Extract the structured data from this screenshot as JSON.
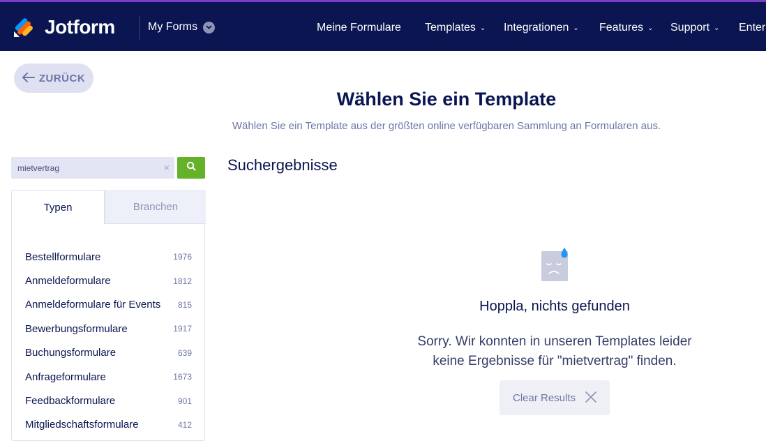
{
  "header": {
    "brand": "Jotform",
    "my_forms": "My Forms",
    "nav": [
      {
        "label": "Meine Formulare",
        "has_caret": false
      },
      {
        "label": "Templates",
        "has_caret": true
      },
      {
        "label": "Integrationen",
        "has_caret": true
      },
      {
        "label": "Features",
        "has_caret": true
      },
      {
        "label": "Support",
        "has_caret": true
      },
      {
        "label": "Enter",
        "has_caret": false
      }
    ],
    "colors": {
      "background": "#0a1551",
      "accent_strip": "#7a3ec8"
    }
  },
  "back_button": {
    "label": "ZURÜCK",
    "icon": "arrow-left-icon"
  },
  "page": {
    "title": "Wählen Sie ein Template",
    "subtitle": "Wählen Sie ein Template aus der größten online verfügbaren Sammlung an Formularen aus."
  },
  "search": {
    "value": "mietvertrag",
    "button_icon": "search-icon",
    "button_color": "#64b22a"
  },
  "tabs": [
    {
      "label": "Typen",
      "active": true
    },
    {
      "label": "Branchen",
      "active": false
    }
  ],
  "categories": [
    {
      "name": "Bestellformulare",
      "count": "1976"
    },
    {
      "name": "Anmeldeformulare",
      "count": "1812"
    },
    {
      "name": "Anmeldeformulare für Events",
      "count": "815"
    },
    {
      "name": "Bewerbungsformulare",
      "count": "1917"
    },
    {
      "name": "Buchungsformulare",
      "count": "639"
    },
    {
      "name": "Anfrageformulare",
      "count": "1673"
    },
    {
      "name": "Feedbackformulare",
      "count": "901"
    },
    {
      "name": "Mitgliedschaftsformulare",
      "count": "412"
    }
  ],
  "results": {
    "heading": "Suchergebnisse",
    "empty_icon": "sad-face-icon",
    "empty_title": "Hoppla, nichts gefunden",
    "empty_line1": "Sorry. Wir konnten in unseren Templates leider",
    "empty_line2": "keine Ergebnisse für \"mietvertrag\" finden.",
    "clear_label": "Clear Results"
  }
}
